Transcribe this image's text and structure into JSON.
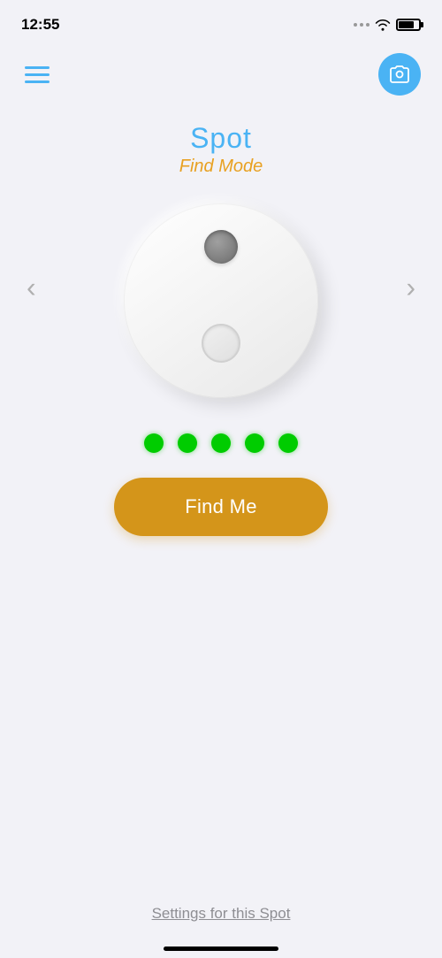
{
  "statusBar": {
    "time": "12:55",
    "wifiIcon": "wifi",
    "batteryIcon": "battery"
  },
  "header": {
    "menuIcon": "hamburger-menu",
    "cameraIcon": "camera"
  },
  "device": {
    "title": "Spot",
    "mode": "Find Mode",
    "signalDots": [
      1,
      2,
      3,
      4,
      5
    ],
    "signalColor": "#00cc00"
  },
  "navigation": {
    "leftArrow": "‹",
    "rightArrow": "›"
  },
  "actions": {
    "findMeButton": "Find Me"
  },
  "footer": {
    "settingsLink": "Settings for this Spot"
  }
}
